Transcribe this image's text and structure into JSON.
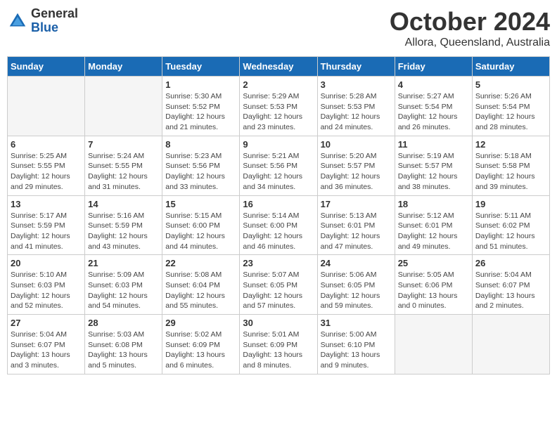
{
  "header": {
    "logo_general": "General",
    "logo_blue": "Blue",
    "month_title": "October 2024",
    "location": "Allora, Queensland, Australia"
  },
  "weekdays": [
    "Sunday",
    "Monday",
    "Tuesday",
    "Wednesday",
    "Thursday",
    "Friday",
    "Saturday"
  ],
  "weeks": [
    [
      {
        "day": null,
        "sunrise": null,
        "sunset": null,
        "daylight": null
      },
      {
        "day": null,
        "sunrise": null,
        "sunset": null,
        "daylight": null
      },
      {
        "day": "1",
        "sunrise": "Sunrise: 5:30 AM",
        "sunset": "Sunset: 5:52 PM",
        "daylight": "Daylight: 12 hours and 21 minutes."
      },
      {
        "day": "2",
        "sunrise": "Sunrise: 5:29 AM",
        "sunset": "Sunset: 5:53 PM",
        "daylight": "Daylight: 12 hours and 23 minutes."
      },
      {
        "day": "3",
        "sunrise": "Sunrise: 5:28 AM",
        "sunset": "Sunset: 5:53 PM",
        "daylight": "Daylight: 12 hours and 24 minutes."
      },
      {
        "day": "4",
        "sunrise": "Sunrise: 5:27 AM",
        "sunset": "Sunset: 5:54 PM",
        "daylight": "Daylight: 12 hours and 26 minutes."
      },
      {
        "day": "5",
        "sunrise": "Sunrise: 5:26 AM",
        "sunset": "Sunset: 5:54 PM",
        "daylight": "Daylight: 12 hours and 28 minutes."
      }
    ],
    [
      {
        "day": "6",
        "sunrise": "Sunrise: 5:25 AM",
        "sunset": "Sunset: 5:55 PM",
        "daylight": "Daylight: 12 hours and 29 minutes."
      },
      {
        "day": "7",
        "sunrise": "Sunrise: 5:24 AM",
        "sunset": "Sunset: 5:55 PM",
        "daylight": "Daylight: 12 hours and 31 minutes."
      },
      {
        "day": "8",
        "sunrise": "Sunrise: 5:23 AM",
        "sunset": "Sunset: 5:56 PM",
        "daylight": "Daylight: 12 hours and 33 minutes."
      },
      {
        "day": "9",
        "sunrise": "Sunrise: 5:21 AM",
        "sunset": "Sunset: 5:56 PM",
        "daylight": "Daylight: 12 hours and 34 minutes."
      },
      {
        "day": "10",
        "sunrise": "Sunrise: 5:20 AM",
        "sunset": "Sunset: 5:57 PM",
        "daylight": "Daylight: 12 hours and 36 minutes."
      },
      {
        "day": "11",
        "sunrise": "Sunrise: 5:19 AM",
        "sunset": "Sunset: 5:57 PM",
        "daylight": "Daylight: 12 hours and 38 minutes."
      },
      {
        "day": "12",
        "sunrise": "Sunrise: 5:18 AM",
        "sunset": "Sunset: 5:58 PM",
        "daylight": "Daylight: 12 hours and 39 minutes."
      }
    ],
    [
      {
        "day": "13",
        "sunrise": "Sunrise: 5:17 AM",
        "sunset": "Sunset: 5:59 PM",
        "daylight": "Daylight: 12 hours and 41 minutes."
      },
      {
        "day": "14",
        "sunrise": "Sunrise: 5:16 AM",
        "sunset": "Sunset: 5:59 PM",
        "daylight": "Daylight: 12 hours and 43 minutes."
      },
      {
        "day": "15",
        "sunrise": "Sunrise: 5:15 AM",
        "sunset": "Sunset: 6:00 PM",
        "daylight": "Daylight: 12 hours and 44 minutes."
      },
      {
        "day": "16",
        "sunrise": "Sunrise: 5:14 AM",
        "sunset": "Sunset: 6:00 PM",
        "daylight": "Daylight: 12 hours and 46 minutes."
      },
      {
        "day": "17",
        "sunrise": "Sunrise: 5:13 AM",
        "sunset": "Sunset: 6:01 PM",
        "daylight": "Daylight: 12 hours and 47 minutes."
      },
      {
        "day": "18",
        "sunrise": "Sunrise: 5:12 AM",
        "sunset": "Sunset: 6:01 PM",
        "daylight": "Daylight: 12 hours and 49 minutes."
      },
      {
        "day": "19",
        "sunrise": "Sunrise: 5:11 AM",
        "sunset": "Sunset: 6:02 PM",
        "daylight": "Daylight: 12 hours and 51 minutes."
      }
    ],
    [
      {
        "day": "20",
        "sunrise": "Sunrise: 5:10 AM",
        "sunset": "Sunset: 6:03 PM",
        "daylight": "Daylight: 12 hours and 52 minutes."
      },
      {
        "day": "21",
        "sunrise": "Sunrise: 5:09 AM",
        "sunset": "Sunset: 6:03 PM",
        "daylight": "Daylight: 12 hours and 54 minutes."
      },
      {
        "day": "22",
        "sunrise": "Sunrise: 5:08 AM",
        "sunset": "Sunset: 6:04 PM",
        "daylight": "Daylight: 12 hours and 55 minutes."
      },
      {
        "day": "23",
        "sunrise": "Sunrise: 5:07 AM",
        "sunset": "Sunset: 6:05 PM",
        "daylight": "Daylight: 12 hours and 57 minutes."
      },
      {
        "day": "24",
        "sunrise": "Sunrise: 5:06 AM",
        "sunset": "Sunset: 6:05 PM",
        "daylight": "Daylight: 12 hours and 59 minutes."
      },
      {
        "day": "25",
        "sunrise": "Sunrise: 5:05 AM",
        "sunset": "Sunset: 6:06 PM",
        "daylight": "Daylight: 13 hours and 0 minutes."
      },
      {
        "day": "26",
        "sunrise": "Sunrise: 5:04 AM",
        "sunset": "Sunset: 6:07 PM",
        "daylight": "Daylight: 13 hours and 2 minutes."
      }
    ],
    [
      {
        "day": "27",
        "sunrise": "Sunrise: 5:04 AM",
        "sunset": "Sunset: 6:07 PM",
        "daylight": "Daylight: 13 hours and 3 minutes."
      },
      {
        "day": "28",
        "sunrise": "Sunrise: 5:03 AM",
        "sunset": "Sunset: 6:08 PM",
        "daylight": "Daylight: 13 hours and 5 minutes."
      },
      {
        "day": "29",
        "sunrise": "Sunrise: 5:02 AM",
        "sunset": "Sunset: 6:09 PM",
        "daylight": "Daylight: 13 hours and 6 minutes."
      },
      {
        "day": "30",
        "sunrise": "Sunrise: 5:01 AM",
        "sunset": "Sunset: 6:09 PM",
        "daylight": "Daylight: 13 hours and 8 minutes."
      },
      {
        "day": "31",
        "sunrise": "Sunrise: 5:00 AM",
        "sunset": "Sunset: 6:10 PM",
        "daylight": "Daylight: 13 hours and 9 minutes."
      },
      {
        "day": null,
        "sunrise": null,
        "sunset": null,
        "daylight": null
      },
      {
        "day": null,
        "sunrise": null,
        "sunset": null,
        "daylight": null
      }
    ]
  ]
}
